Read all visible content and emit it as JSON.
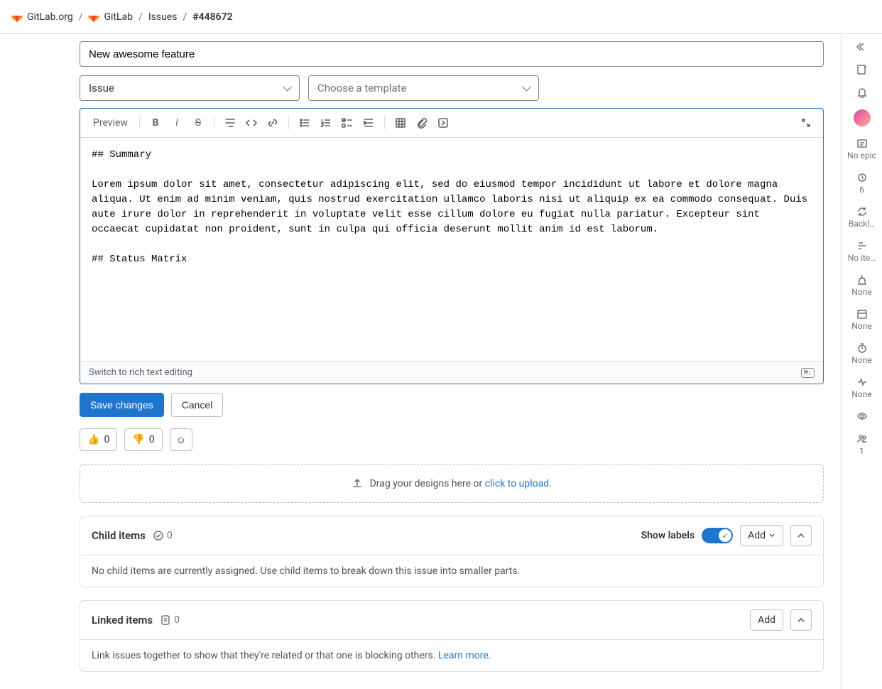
{
  "breadcrumbs": {
    "org": "GitLab.org",
    "project": "GitLab",
    "section": "Issues",
    "id": "#448672"
  },
  "title_input": "New awesome feature",
  "type_select": "Issue",
  "template_select": "Choose a template",
  "toolbar": {
    "preview": "Preview"
  },
  "editor_content": "## Summary\n\nLorem ipsum dolor sit amet, consectetur adipiscing elit, sed do eiusmod tempor incididunt ut labore et dolore magna aliqua. Ut enim ad minim veniam, quis nostrud exercitation ullamco laboris nisi ut aliquip ex ea commodo consequat. Duis aute irure dolor in reprehenderit in voluptate velit esse cillum dolore eu fugiat nulla pariatur. Excepteur sint occaecat cupidatat non proident, sunt in culpa qui officia deserunt mollit anim id est laborum.\n\n## Status Matrix\n\n\n",
  "editor_footer": {
    "switch": "Switch to rich text editing",
    "md": "M↓"
  },
  "actions": {
    "save": "Save changes",
    "cancel": "Cancel"
  },
  "reactions": {
    "up": "👍",
    "up_count": "0",
    "down": "👎",
    "down_count": "0",
    "add": "☺"
  },
  "dropzone": {
    "pre": "Drag your designs here or ",
    "link": "click to upload",
    "post": "."
  },
  "child_items": {
    "title": "Child items",
    "count": "0",
    "show_labels": "Show labels",
    "add": "Add",
    "empty": "No child items are currently assigned. Use child items to break down this issue into smaller parts."
  },
  "linked_items": {
    "title": "Linked items",
    "count": "0",
    "add": "Add",
    "empty_pre": "Link issues together to show that they're related or that one is blocking others. ",
    "learn": "Learn more."
  },
  "rail": {
    "epic": "No epic",
    "milestone_count": "6",
    "iteration": "Backl…",
    "roadmap": "No ite…",
    "weight": "None",
    "due": "None",
    "time": "None",
    "health": "None",
    "participants": "1"
  }
}
